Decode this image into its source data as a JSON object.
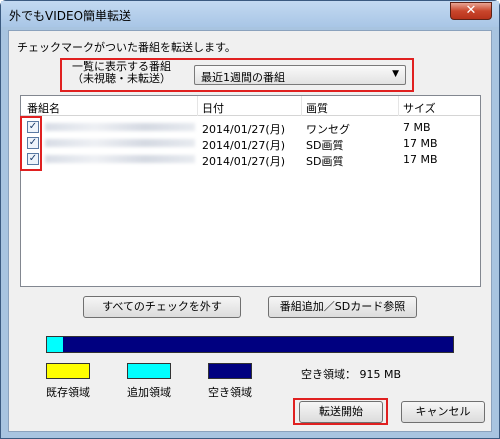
{
  "window": {
    "title": "外でもVIDEO簡単転送",
    "close_glyph": "✕"
  },
  "instruction": "チェックマークがついた番組を転送します。",
  "filter": {
    "label_line1": "一覧に表示する番組",
    "label_line2": "（未視聴・未転送）",
    "selected": "最近1週間の番組"
  },
  "list": {
    "columns": [
      "番組名",
      "日付",
      "画質",
      "サイズ"
    ],
    "rows": [
      {
        "checked": true,
        "date": "2014/01/27(月)",
        "quality": "ワンセグ",
        "size": "7 MB"
      },
      {
        "checked": true,
        "date": "2014/01/27(月)",
        "quality": "SD画質",
        "size": "17 MB"
      },
      {
        "checked": true,
        "date": "2014/01/27(月)",
        "quality": "SD画質",
        "size": "17 MB"
      }
    ]
  },
  "buttons": {
    "uncheck_all": "すべてのチェックを外す",
    "add_program": "番組追加／SDカード参照",
    "start": "転送開始",
    "cancel": "キャンセル"
  },
  "storage": {
    "added_fraction": 0.04,
    "legend": {
      "existing": "既存領域",
      "added": "追加領域",
      "free": "空き領域"
    },
    "free_label": "空き領域：",
    "free_value": "915 MB"
  },
  "colors": {
    "existing": "#ffff00",
    "added": "#00ffff",
    "free": "#000080",
    "highlight": "#e02020"
  }
}
